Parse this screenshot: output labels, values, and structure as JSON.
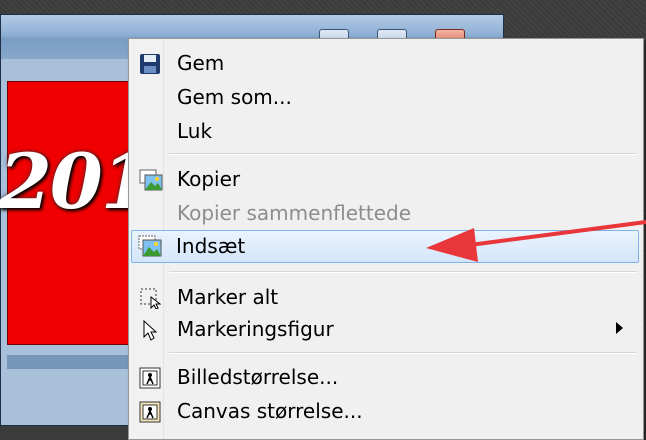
{
  "menu": {
    "items": [
      {
        "label": "Gem",
        "icon": "save-icon",
        "enabled": true
      },
      {
        "label": "Gem som...",
        "icon": "",
        "enabled": true
      },
      {
        "label": "Luk",
        "icon": "",
        "enabled": true
      },
      {
        "label": "Kopier",
        "icon": "copy-image-icon",
        "enabled": true
      },
      {
        "label": "Kopier sammenflettede",
        "icon": "",
        "enabled": false
      },
      {
        "label": "Indsæt",
        "icon": "paste-image-icon",
        "enabled": true,
        "highlighted": true
      },
      {
        "label": "Marker alt",
        "icon": "select-all-icon",
        "enabled": true
      },
      {
        "label": "Markeringsfigur",
        "icon": "selection-pointer-icon",
        "enabled": true,
        "has_submenu": true
      },
      {
        "label": "Billedstørrelse...",
        "icon": "image-size-icon",
        "enabled": true
      },
      {
        "label": "Canvas størrelse...",
        "icon": "canvas-size-icon",
        "enabled": true
      }
    ]
  },
  "canvas": {
    "text": "201",
    "color": "#f00000"
  },
  "annotation": {
    "arrow_color": "#e8363a"
  }
}
